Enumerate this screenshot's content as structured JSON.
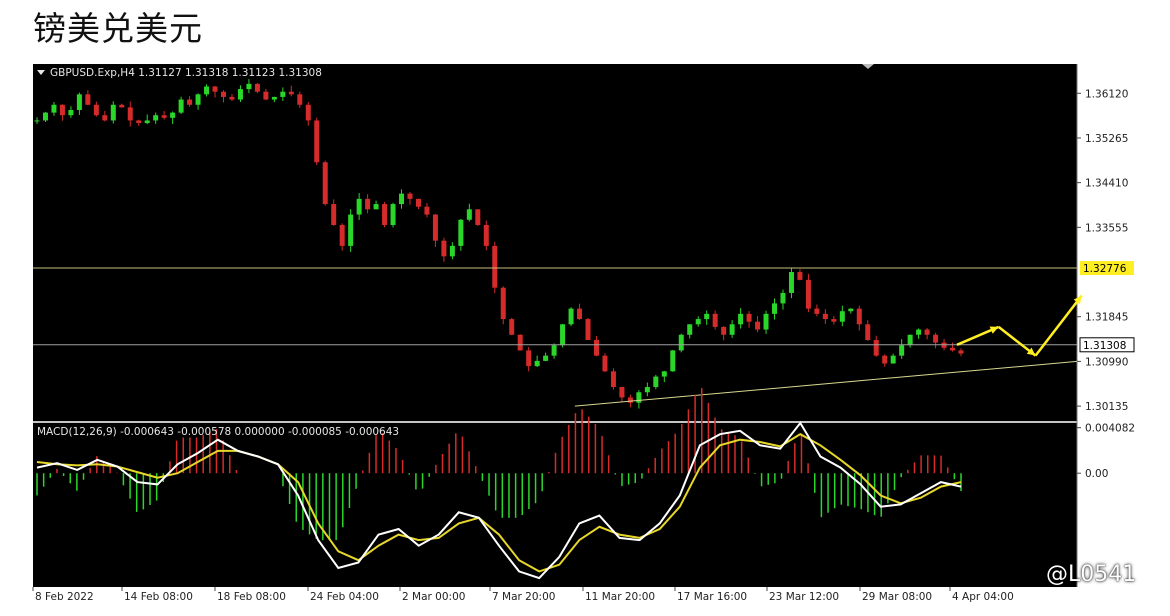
{
  "page": {
    "title": "镑美兑美元"
  },
  "watermark": {
    "text": "@L0541"
  },
  "colors": {
    "background": "#000000",
    "bull": "#2bd62b",
    "bear": "#d62b2b",
    "macd_main": "#ffffff",
    "macd_signal": "#e6d72a",
    "level_line": "#c8bf7a",
    "price_line": "#a0a0a0",
    "arrow": "#ffee22"
  },
  "chart_data": [
    {
      "type": "candlestick",
      "header": "GBPUSD.Exp,H4  1.31127 1.31318 1.31123 1.31308",
      "symbol": "GBPUSD.Exp",
      "timeframe": "H4",
      "ohlc_current": {
        "open": 1.31127,
        "high": 1.31318,
        "low": 1.31123,
        "close": 1.31308
      },
      "ylim": [
        1.2985,
        1.3668
      ],
      "y_ticks": [
        1.3612,
        1.35265,
        1.3441,
        1.33555,
        1.30135
      ],
      "y_tick_labels": [
        "1.36120",
        "1.35265",
        "1.34410",
        "1.33555",
        "1.31845",
        "1.30990",
        "1.30135"
      ],
      "y_tick_values": [
        1.3612,
        1.35265,
        1.3441,
        1.33555,
        1.31845,
        1.3099,
        1.30135
      ],
      "horizontal_levels": [
        {
          "value": 1.32776,
          "label": "1.32776"
        }
      ],
      "current_price": {
        "value": 1.31308,
        "label": "1.31308"
      },
      "trendline": {
        "from": [
          0.568,
          1.30135
        ],
        "to": [
          1.0,
          1.3099
        ]
      },
      "x_tick_labels": [
        "8 Feb 2022",
        "14 Feb 08:00",
        "18 Feb 08:00",
        "24 Feb 04:00",
        "2 Mar 00:00",
        "7 Mar 20:00",
        "11 Mar 20:00",
        "17 Mar 16:00",
        "23 Mar 12:00",
        "29 Mar 08:00",
        "4 Apr 04:00"
      ],
      "close_path": [
        1.356,
        1.3575,
        1.359,
        1.357,
        1.358,
        1.361,
        1.359,
        1.357,
        1.356,
        1.359,
        1.3585,
        1.356,
        1.3555,
        1.356,
        1.357,
        1.3565,
        1.3575,
        1.36,
        1.359,
        1.361,
        1.3625,
        1.3615,
        1.3605,
        1.36,
        1.362,
        1.363,
        1.3615,
        1.36,
        1.3605,
        1.3615,
        1.361,
        1.359,
        1.356,
        1.348,
        1.34,
        1.336,
        1.332,
        1.338,
        1.341,
        1.339,
        1.34,
        1.336,
        1.34,
        1.342,
        1.341,
        1.3395,
        1.338,
        1.333,
        1.33,
        1.332,
        1.337,
        1.339,
        1.336,
        1.332,
        1.324,
        1.318,
        1.315,
        1.312,
        1.309,
        1.31,
        1.311,
        1.313,
        1.317,
        1.32,
        1.318,
        1.314,
        1.311,
        1.308,
        1.305,
        1.303,
        1.302,
        1.304,
        1.305,
        1.307,
        1.308,
        1.312,
        1.315,
        1.317,
        1.318,
        1.319,
        1.3165,
        1.315,
        1.317,
        1.319,
        1.3175,
        1.316,
        1.319,
        1.321,
        1.323,
        1.327,
        1.3255,
        1.32,
        1.319,
        1.318,
        1.3175,
        1.3195,
        1.32,
        1.317,
        1.314,
        1.311,
        1.3095,
        1.311,
        1.313,
        1.315,
        1.316,
        1.315,
        1.3135,
        1.3125,
        1.312,
        1.3114
      ],
      "arrow_projection": [
        [
          1.0,
          1.31308
        ],
        [
          1.045,
          1.3165
        ],
        [
          1.085,
          1.311
        ],
        [
          1.135,
          1.3225
        ]
      ]
    },
    {
      "type": "line",
      "header": "MACD(12,26,9) -0.000643 -0.000578 0.000000 -0.000085 -0.000643",
      "indicator": "MACD(12,26,9)",
      "values_shown": [
        -0.000643,
        -0.000578,
        0.0,
        -8.5e-05,
        -0.000643
      ],
      "ylim": [
        -0.0102,
        0.0045
      ],
      "y_tick_labels": [
        "0.004082",
        "0.00"
      ],
      "y_tick_values": [
        0.004082,
        0.0
      ],
      "main": [
        0.0005,
        0.0009,
        0.0003,
        0.0012,
        0.0006,
        -0.0008,
        -0.001,
        0.0008,
        0.0018,
        0.003,
        0.002,
        0.0015,
        0.0008,
        -0.002,
        -0.006,
        -0.0085,
        -0.008,
        -0.0055,
        -0.005,
        -0.0065,
        -0.0055,
        -0.0035,
        -0.004,
        -0.0065,
        -0.0088,
        -0.0094,
        -0.0075,
        -0.0045,
        -0.0038,
        -0.0058,
        -0.006,
        -0.0045,
        -0.002,
        0.0025,
        0.0035,
        0.0038,
        0.0025,
        0.0022,
        0.0045,
        0.0015,
        0.0005,
        -0.001,
        -0.003,
        -0.0028,
        -0.0018,
        -0.0008,
        -0.0012
      ],
      "signal": [
        0.001,
        0.0008,
        0.0007,
        0.0008,
        0.0006,
        0.0001,
        -0.0004,
        0.0,
        0.001,
        0.002,
        0.002,
        0.0015,
        0.0008,
        -0.0008,
        -0.0045,
        -0.007,
        -0.0078,
        -0.0065,
        -0.0055,
        -0.006,
        -0.0058,
        -0.0045,
        -0.004,
        -0.0055,
        -0.0078,
        -0.0088,
        -0.0082,
        -0.006,
        -0.0048,
        -0.0055,
        -0.0058,
        -0.005,
        -0.003,
        0.0005,
        0.0025,
        0.003,
        0.0028,
        0.0024,
        0.0035,
        0.0025,
        0.0012,
        -0.0002,
        -0.002,
        -0.0027,
        -0.0022,
        -0.0012,
        -0.0008
      ]
    }
  ]
}
